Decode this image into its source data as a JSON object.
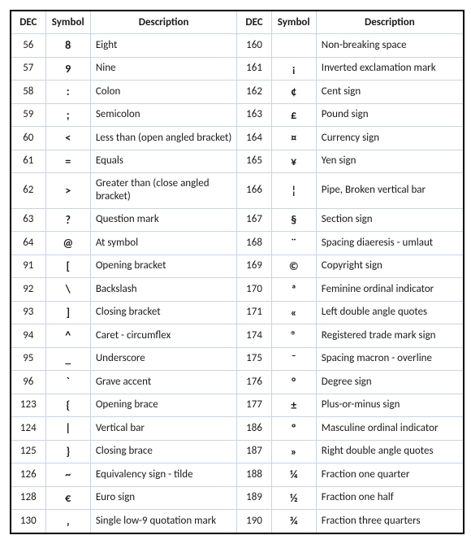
{
  "headers": {
    "dec": "DEC",
    "symbol": "Symbol",
    "description": "Description"
  },
  "chart_data": {
    "type": "table",
    "title": "",
    "columns": [
      "DEC",
      "Symbol",
      "Description",
      "DEC",
      "Symbol",
      "Description"
    ],
    "rows": [
      {
        "l": {
          "dec": "56",
          "sym": "8",
          "desc": "Eight"
        },
        "r": {
          "dec": "160",
          "sym": "",
          "desc": "Non-breaking space"
        }
      },
      {
        "l": {
          "dec": "57",
          "sym": "9",
          "desc": "Nine"
        },
        "r": {
          "dec": "161",
          "sym": "¡",
          "desc": "Inverted exclamation mark"
        }
      },
      {
        "l": {
          "dec": "58",
          "sym": ":",
          "desc": "Colon"
        },
        "r": {
          "dec": "162",
          "sym": "¢",
          "desc": "Cent sign"
        }
      },
      {
        "l": {
          "dec": "59",
          "sym": ";",
          "desc": "Semicolon"
        },
        "r": {
          "dec": "163",
          "sym": "£",
          "desc": "Pound sign"
        }
      },
      {
        "l": {
          "dec": "60",
          "sym": "<",
          "desc": "Less than (open angled bracket)"
        },
        "r": {
          "dec": "164",
          "sym": "¤",
          "desc": "Currency sign"
        }
      },
      {
        "l": {
          "dec": "61",
          "sym": "=",
          "desc": "Equals"
        },
        "r": {
          "dec": "165",
          "sym": "¥",
          "desc": "Yen sign"
        }
      },
      {
        "l": {
          "dec": "62",
          "sym": ">",
          "desc": "Greater than (close angled bracket)"
        },
        "r": {
          "dec": "166",
          "sym": "¦",
          "desc": "Pipe, Broken vertical bar"
        }
      },
      {
        "l": {
          "dec": "63",
          "sym": "?",
          "desc": "Question mark"
        },
        "r": {
          "dec": "167",
          "sym": "§",
          "desc": "Section sign"
        }
      },
      {
        "l": {
          "dec": "64",
          "sym": "@",
          "desc": "At symbol"
        },
        "r": {
          "dec": "168",
          "sym": "¨",
          "desc": "Spacing diaeresis - umlaut"
        }
      },
      {
        "l": {
          "dec": "91",
          "sym": "[",
          "desc": "Opening bracket"
        },
        "r": {
          "dec": "169",
          "sym": "©",
          "desc": "Copyright sign"
        }
      },
      {
        "l": {
          "dec": "92",
          "sym": "\\",
          "desc": "Backslash"
        },
        "r": {
          "dec": "170",
          "sym": "ª",
          "desc": "Feminine ordinal indicator"
        }
      },
      {
        "l": {
          "dec": "93",
          "sym": "]",
          "desc": "Closing bracket"
        },
        "r": {
          "dec": "171",
          "sym": "«",
          "desc": "Left double angle quotes"
        }
      },
      {
        "l": {
          "dec": "94",
          "sym": "^",
          "desc": "Caret - circumflex"
        },
        "r": {
          "dec": "174",
          "sym": "®",
          "desc": "Registered trade mark sign"
        }
      },
      {
        "l": {
          "dec": "95",
          "sym": "_",
          "desc": "Underscore"
        },
        "r": {
          "dec": "175",
          "sym": "¯",
          "desc": "Spacing macron - overline"
        }
      },
      {
        "l": {
          "dec": "96",
          "sym": "`",
          "desc": "Grave accent"
        },
        "r": {
          "dec": "176",
          "sym": "°",
          "desc": "Degree sign"
        }
      },
      {
        "l": {
          "dec": "123",
          "sym": "{",
          "desc": "Opening brace"
        },
        "r": {
          "dec": "177",
          "sym": "±",
          "desc": "Plus-or-minus sign"
        }
      },
      {
        "l": {
          "dec": "124",
          "sym": "|",
          "desc": "Vertical bar"
        },
        "r": {
          "dec": "186",
          "sym": "º",
          "desc": "Masculine ordinal indicator"
        }
      },
      {
        "l": {
          "dec": "125",
          "sym": "}",
          "desc": "Closing brace"
        },
        "r": {
          "dec": "187",
          "sym": "»",
          "desc": "Right double angle quotes"
        }
      },
      {
        "l": {
          "dec": "126",
          "sym": "~",
          "desc": "Equivalency sign - tilde"
        },
        "r": {
          "dec": "188",
          "sym": "¼",
          "desc": "Fraction one quarter"
        }
      },
      {
        "l": {
          "dec": "128",
          "sym": "€",
          "desc": "Euro sign"
        },
        "r": {
          "dec": "189",
          "sym": "½",
          "desc": "Fraction one half"
        }
      },
      {
        "l": {
          "dec": "130",
          "sym": "‚",
          "desc": "Single low-9 quotation mark"
        },
        "r": {
          "dec": "190",
          "sym": "¾",
          "desc": "Fraction three quarters"
        }
      }
    ]
  }
}
